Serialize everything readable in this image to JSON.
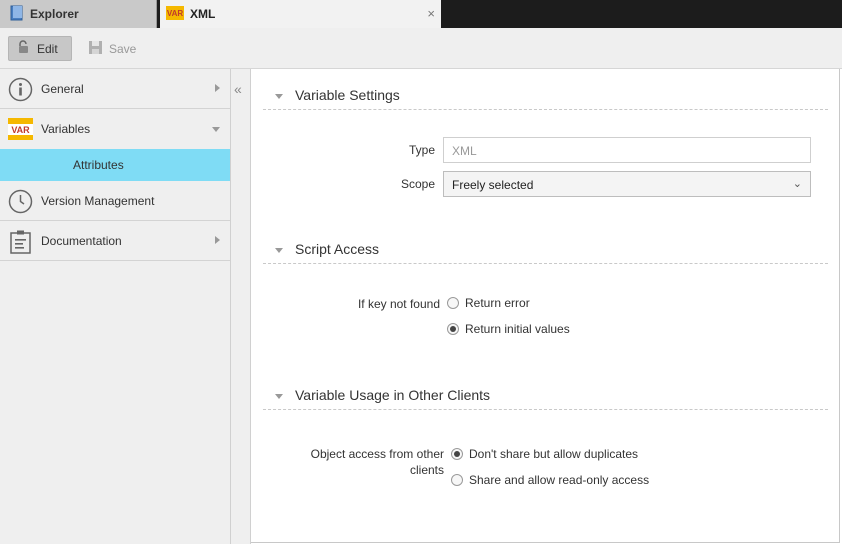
{
  "tabs": [
    {
      "label": "Explorer",
      "icon": "explorer-book-icon"
    },
    {
      "label": "XML",
      "icon": "var-icon",
      "close": "×"
    }
  ],
  "toolbar": {
    "edit_label": "Edit",
    "save_label": "Save"
  },
  "sidebar": {
    "items": [
      {
        "label": "General",
        "icon": "info-icon"
      },
      {
        "label": "Variables",
        "icon": "var-icon",
        "icon_text": "VAR"
      },
      {
        "label": "Attributes"
      },
      {
        "label": "Version Management",
        "icon": "clock-icon"
      },
      {
        "label": "Documentation",
        "icon": "clipboard-icon"
      }
    ],
    "collapse_glyph": "«"
  },
  "sections": {
    "variable_settings": {
      "title": "Variable Settings",
      "type_label": "Type",
      "type_placeholder": "XML",
      "scope_label": "Scope",
      "scope_value": "Freely selected"
    },
    "script_access": {
      "title": "Script Access",
      "label": "If key not found",
      "options": [
        "Return error",
        "Return initial values"
      ],
      "selected": "Return initial values"
    },
    "usage": {
      "title": "Variable Usage in Other Clients",
      "label_line1": "Object access from other",
      "label_line2": "clients",
      "options": [
        "Don't share but allow duplicates",
        "Share and allow read-only access"
      ],
      "selected": "Don't share but allow duplicates"
    }
  },
  "colors": {
    "selected_nav": "#7fdcf5",
    "var_icon_bg": "#f5b800",
    "var_icon_text": "#c0392b"
  }
}
